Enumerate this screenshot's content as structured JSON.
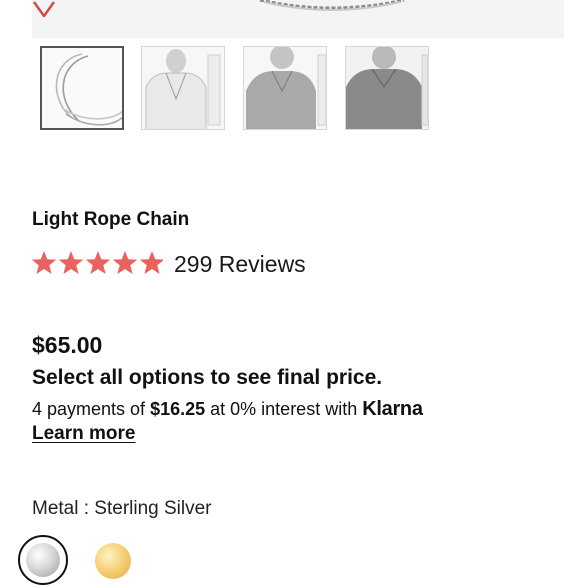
{
  "product": {
    "title": "Light Rope Chain",
    "rating": {
      "stars": 5,
      "reviews_label": "299 Reviews"
    },
    "price": "$65.00",
    "options_note": "Select all options to see final price.",
    "klarna": {
      "prefix": "4 payments of ",
      "amount": "$16.25",
      "middle": " at 0% interest with ",
      "brand": "Klarna",
      "learn_more": "Learn more"
    },
    "metal": {
      "label": "Metal : Sterling Silver",
      "options": [
        "silver-swatch",
        "gold-swatch"
      ],
      "selected": "silver-swatch"
    }
  },
  "gallery": {
    "thumbnails": [
      "chain-closeup",
      "model-front",
      "model-neck",
      "model-shirt"
    ],
    "selected_index": 0
  },
  "colors": {
    "star": "#e86360",
    "heart": "#d5483f",
    "text": "#111111"
  },
  "icons": {
    "wishlist": "heart-outline-icon",
    "rating": "star-icon"
  }
}
